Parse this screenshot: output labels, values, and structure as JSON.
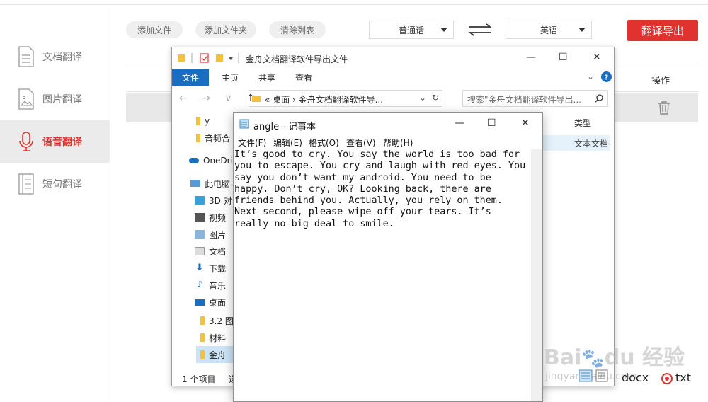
{
  "sidebar": {
    "items": [
      {
        "label": "文档翻译",
        "icon": "document-icon"
      },
      {
        "label": "图片翻译",
        "icon": "image-icon"
      },
      {
        "label": "语音翻译",
        "icon": "microphone-icon",
        "active": true
      },
      {
        "label": "短句翻译",
        "icon": "short-text-icon"
      }
    ]
  },
  "toolbar": {
    "add_file": "添加文件",
    "add_folder": "添加文件夹",
    "clear_list": "清除列表",
    "source_lang": "普通话",
    "target_lang": "英语",
    "export": "翻译导出"
  },
  "table": {
    "op_header": "操作"
  },
  "explorer": {
    "title": "金舟文档翻译软件导出文件",
    "ribbon": {
      "file": "文件",
      "home": "主页",
      "share": "共享",
      "view": "查看"
    },
    "address": "«  桌面  ›  金舟文档翻译软件导...",
    "search_placeholder": "搜索\"金舟文档翻译软件导出...",
    "tree": [
      {
        "label": "y"
      },
      {
        "label": "音频合"
      },
      {
        "label": "OneDriv"
      },
      {
        "label": "此电脑"
      },
      {
        "label": "3D 对"
      },
      {
        "label": "视频"
      },
      {
        "label": "图片"
      },
      {
        "label": "文档"
      },
      {
        "label": "下载"
      },
      {
        "label": "音乐"
      },
      {
        "label": "桌面"
      },
      {
        "label": "3.2 图"
      },
      {
        "label": "材料"
      },
      {
        "label": "金舟"
      }
    ],
    "col_type": "类型",
    "row_type": "文本文档",
    "status": "1 个项目",
    "status_extra": "选"
  },
  "notepad": {
    "title": "angle - 记事本",
    "menu": [
      "文件(F)",
      "编辑(E)",
      "格式(O)",
      "查看(V)",
      "帮助(H)"
    ],
    "content": "It’s good to cry. You say the world is too bad for\nyou to escape. You cry and laugh with red eyes. You\nsay you don’t want my android. You need to be\nhappy. Don’t cry, OK? Looking back, there are\nfriends behind you. Actually, you rely on them.\nNext second, please wipe off your tears. It’s\nreally no big deal to smile."
  },
  "formats": {
    "docx": "docx",
    "txt": "txt"
  },
  "watermark": {
    "main": "Bai du 经验",
    "sub": "jingyan.baidu.com"
  },
  "colors": {
    "accent": "#e0322f",
    "ribbon_blue": "#1a6ec2"
  }
}
